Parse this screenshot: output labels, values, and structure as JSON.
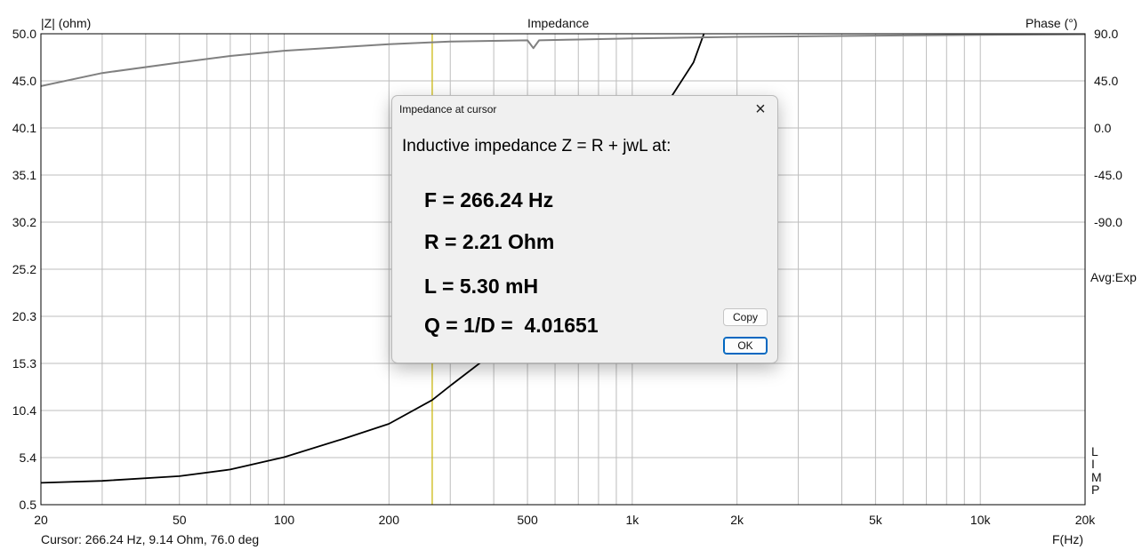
{
  "chart": {
    "title": "Impedance",
    "left_axis_label": "|Z| (ohm)",
    "right_axis_label": "Phase (°)",
    "x_axis_label": "F(Hz)",
    "avg_label": "Avg:Exp",
    "limp_label": [
      "L",
      "I",
      "M",
      "P"
    ],
    "left_ticks": [
      "50.0",
      "45.0",
      "40.1",
      "35.1",
      "30.2",
      "25.2",
      "20.3",
      "15.3",
      "10.4",
      "5.4",
      "0.5"
    ],
    "right_ticks": [
      "90.0",
      "45.0",
      "0.0",
      "-45.0",
      "-90.0"
    ],
    "x_ticks": [
      "20",
      "50",
      "100",
      "200",
      "500",
      "1k",
      "2k",
      "5k",
      "10k",
      "20k"
    ]
  },
  "status": {
    "cursor_text": "Cursor: 266.24 Hz, 9.14 Ohm, 76.0 deg"
  },
  "dialog": {
    "title": "Impedance at cursor",
    "heading": "Inductive impedance Z = R + jwL at:",
    "freq_line": "F = 266.24 Hz",
    "r_line": "R = 2.21 Ohm",
    "l_line": "L = 5.30 mH",
    "q_line": "Q = 1/D =  4.01651",
    "copy_label": "Copy",
    "ok_label": "OK"
  },
  "chart_data": {
    "type": "line",
    "title": "Impedance",
    "xlabel": "F(Hz)",
    "ylabel": "|Z| (ohm)",
    "y2label": "Phase (°)",
    "x_scale": "log",
    "xlim": [
      20,
      20000
    ],
    "ylim": [
      0.5,
      50.0
    ],
    "y2lim": [
      -90,
      90
    ],
    "grid": true,
    "cursor_x": 266.24,
    "series": [
      {
        "axis": "left",
        "color": "#000000",
        "x": [
          20,
          30,
          50,
          70,
          100,
          150,
          200,
          266.24,
          300,
          400,
          500,
          700,
          1000,
          1500,
          1800,
          2000
        ],
        "y": [
          2.8,
          3.0,
          3.5,
          4.2,
          5.5,
          7.5,
          9.0,
          11.5,
          13.0,
          16.5,
          20.5,
          28.5,
          37.0,
          47.0,
          55.0,
          60.0
        ]
      },
      {
        "axis": "right",
        "color": "#808080",
        "x": [
          20,
          30,
          50,
          70,
          100,
          200,
          300,
          500,
          520,
          540,
          700,
          1000,
          2000,
          5000,
          10000,
          20000
        ],
        "y": [
          70.0,
          75.0,
          79.0,
          81.5,
          83.5,
          86.0,
          87.0,
          87.5,
          84.5,
          87.5,
          87.8,
          88.2,
          88.8,
          89.3,
          89.6,
          89.8
        ]
      }
    ]
  }
}
